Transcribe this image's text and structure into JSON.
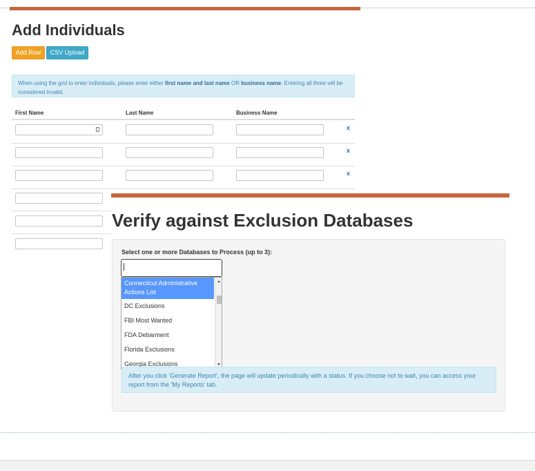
{
  "add_individuals": {
    "title": "Add Individuals",
    "add_row_label": "Add Row",
    "csv_upload_label": "CSV Upload",
    "info": {
      "before": "When using the grid to enter individuals, please enter either ",
      "bold1": "first name and last name",
      "mid": " OR ",
      "bold2": "business name",
      "after": ". Entering all three will be considered invalid."
    },
    "columns": [
      "First Name",
      "Last Name",
      "Business Name"
    ],
    "delete_label": "x"
  },
  "verify": {
    "title": "Verify against Exclusion Databases",
    "select_label": "Select one or more Databases to Process (up to 3):",
    "search_value": "",
    "options": [
      "Connecticut Administrative Actions List",
      "DC Exclusions",
      "FBI Most Wanted",
      "FDA Debarment",
      "Florida Exclusions",
      "Georgia Exclusions"
    ],
    "highlighted_option": "Connecticut Administrative Actions List",
    "report_note": "After you click 'Generate Report', the page will update periodically with a status. If you choose not to wait, you can access your report from the 'My Reports' tab."
  },
  "colors": {
    "accent_orange": "#c8663a",
    "button_orange": "#f0a323",
    "button_blue": "#3fa9c8",
    "info_bg": "#d9edf7",
    "highlight": "#5897fb"
  }
}
